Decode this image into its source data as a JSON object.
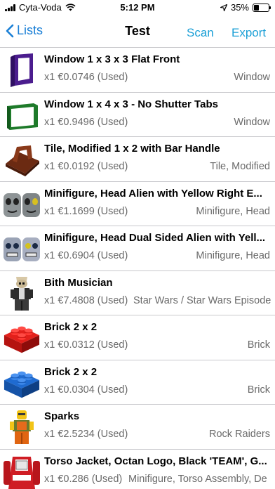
{
  "status": {
    "carrier": "Cyta-Voda",
    "time": "5:12 PM",
    "battery": "35%",
    "battery_level": 0.35
  },
  "nav": {
    "back_label": "Lists",
    "title": "Test",
    "scan_label": "Scan",
    "export_label": "Export"
  },
  "items": [
    {
      "title": "Window 1 x 3 x 3 Flat Front",
      "sub": "x1 €0.0746 (Used)",
      "category": "Window",
      "icon": "purple-window-icon"
    },
    {
      "title": "Window 1 x 4 x 3 - No Shutter Tabs",
      "sub": "x1 €0.9496 (Used)",
      "category": "Window",
      "icon": "green-window-icon"
    },
    {
      "title": "Tile, Modified 1 x 2 with Bar Handle",
      "sub": "x1 €0.0192 (Used)",
      "category": "Tile, Modified",
      "icon": "brown-tile-icon"
    },
    {
      "title": "Minifigure, Head Alien with Yellow Right E...",
      "sub": "x1 €1.1699 (Used)",
      "category": "Minifigure, Head",
      "icon": "alien-head-icon"
    },
    {
      "title": "Minifigure, Head Dual Sided Alien with Yell...",
      "sub": "x1 €0.6904 (Used)",
      "category": "Minifigure, Head",
      "icon": "alien-head-dual-icon"
    },
    {
      "title": "Bith Musician",
      "sub": "x1 €7.4808 (Used)",
      "category": "Star Wars / Star Wars Episode",
      "icon": "bith-minifig-icon"
    },
    {
      "title": "Brick 2 x 2",
      "sub": "x1 €0.0312 (Used)",
      "category": "Brick",
      "icon": "red-brick-icon"
    },
    {
      "title": "Brick 2 x 2",
      "sub": "x1 €0.0304 (Used)",
      "category": "Brick",
      "icon": "blue-brick-icon"
    },
    {
      "title": "Sparks",
      "sub": "x1 €2.5234 (Used)",
      "category": "Rock Raiders",
      "icon": "sparks-minifig-icon"
    },
    {
      "title": "Torso Jacket, Octan Logo, Black 'TEAM', G...",
      "sub": "x1 €0.286 (Used)",
      "category": "Minifigure, Torso Assembly, De",
      "icon": "torso-icon"
    }
  ]
}
